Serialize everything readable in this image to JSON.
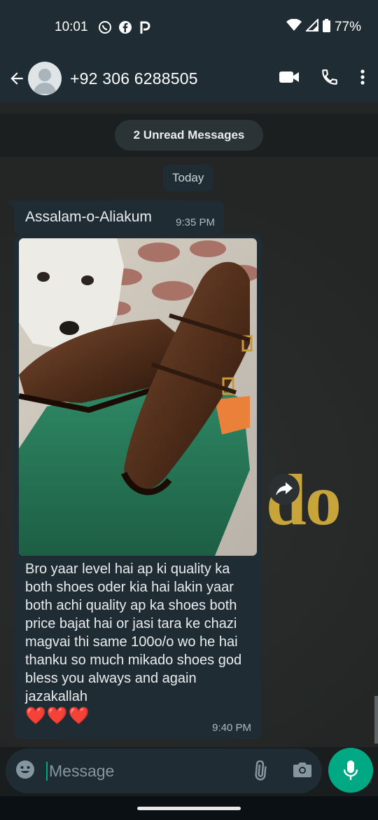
{
  "status_bar": {
    "time": "10:01",
    "battery": "77%",
    "icons": [
      "whatsapp-icon",
      "facebook-icon",
      "pinterest-icon",
      "wifi-icon",
      "signal-icon",
      "battery-icon"
    ]
  },
  "header": {
    "contact_name": "+92 306 6288505",
    "icons": [
      "back-arrow-icon",
      "avatar-icon",
      "video-call-icon",
      "phone-icon",
      "more-vert-icon"
    ]
  },
  "chat": {
    "unread_label": "2 Unread Messages",
    "date_label": "Today",
    "background_logo_text": "do",
    "messages": [
      {
        "text": "Assalam-o-Aliakum",
        "time": "9:35 PM"
      },
      {
        "has_image": true,
        "text": "Bro yaar level hai ap ki quality ka both shoes oder kia hai lakin yaar both achi quality ap ka shoes both price bajat hai or jasi tara ke chazi magvai thi same 100o/o wo he hai thanku so much mikado shoes god bless you always and again jazakallah",
        "emoji": "❤️❤️❤️",
        "time": "9:40 PM"
      }
    ]
  },
  "composer": {
    "placeholder": "Message",
    "icons": [
      "emoji-icon",
      "attach-icon",
      "camera-icon",
      "mic-icon"
    ]
  },
  "colors": {
    "app_bar": "#1f2c34",
    "bubble": "#202c33",
    "accent": "#00a884"
  }
}
